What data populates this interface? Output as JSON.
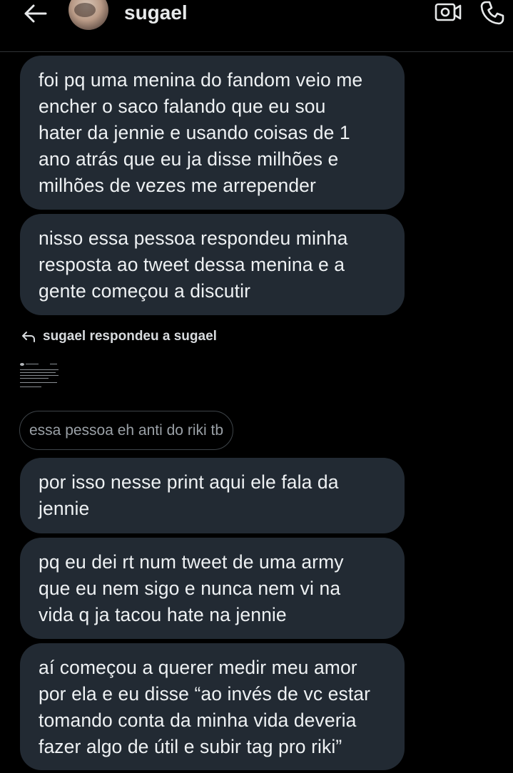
{
  "header": {
    "username": "sugael",
    "back_icon": "arrow-left-icon",
    "video_icon": "video-call-icon",
    "call_icon": "phone-icon"
  },
  "messages_top": [
    {
      "lines": [
        "foi pq uma menina do fandom veio me",
        "encher o saco falando que eu sou",
        "hater da jennie e usando coisas de 1",
        "ano atrás que eu ja disse milhões e",
        "milhões de vezes me arrepender"
      ]
    },
    {
      "lines": [
        "nisso essa pessoa respondeu minha",
        "resposta ao tweet dessa menina e a",
        "gente começou a discutir"
      ]
    }
  ],
  "reply_context": {
    "text": "sugael respondeu a sugael",
    "quoted_message": "essa pessoa eh anti do riki tb"
  },
  "messages_bottom": [
    {
      "lines": [
        "por isso nesse print aqui ele fala da",
        "jennie"
      ]
    },
    {
      "lines": [
        "pq eu dei rt num tweet de uma army",
        "que eu nem sigo e nunca nem vi na",
        "vida q ja tacou hate na jennie"
      ]
    },
    {
      "lines": [
        "aí começou a querer medir meu amor",
        "por ela e eu disse “ao invés de vc estar",
        "tomando conta da minha vida deveria",
        "fazer algo de útil e subir tag pro riki”"
      ]
    }
  ],
  "colors": {
    "background": "#000000",
    "bubble": "#222a33",
    "text": "#eef1f3",
    "divider": "#2f3336"
  }
}
